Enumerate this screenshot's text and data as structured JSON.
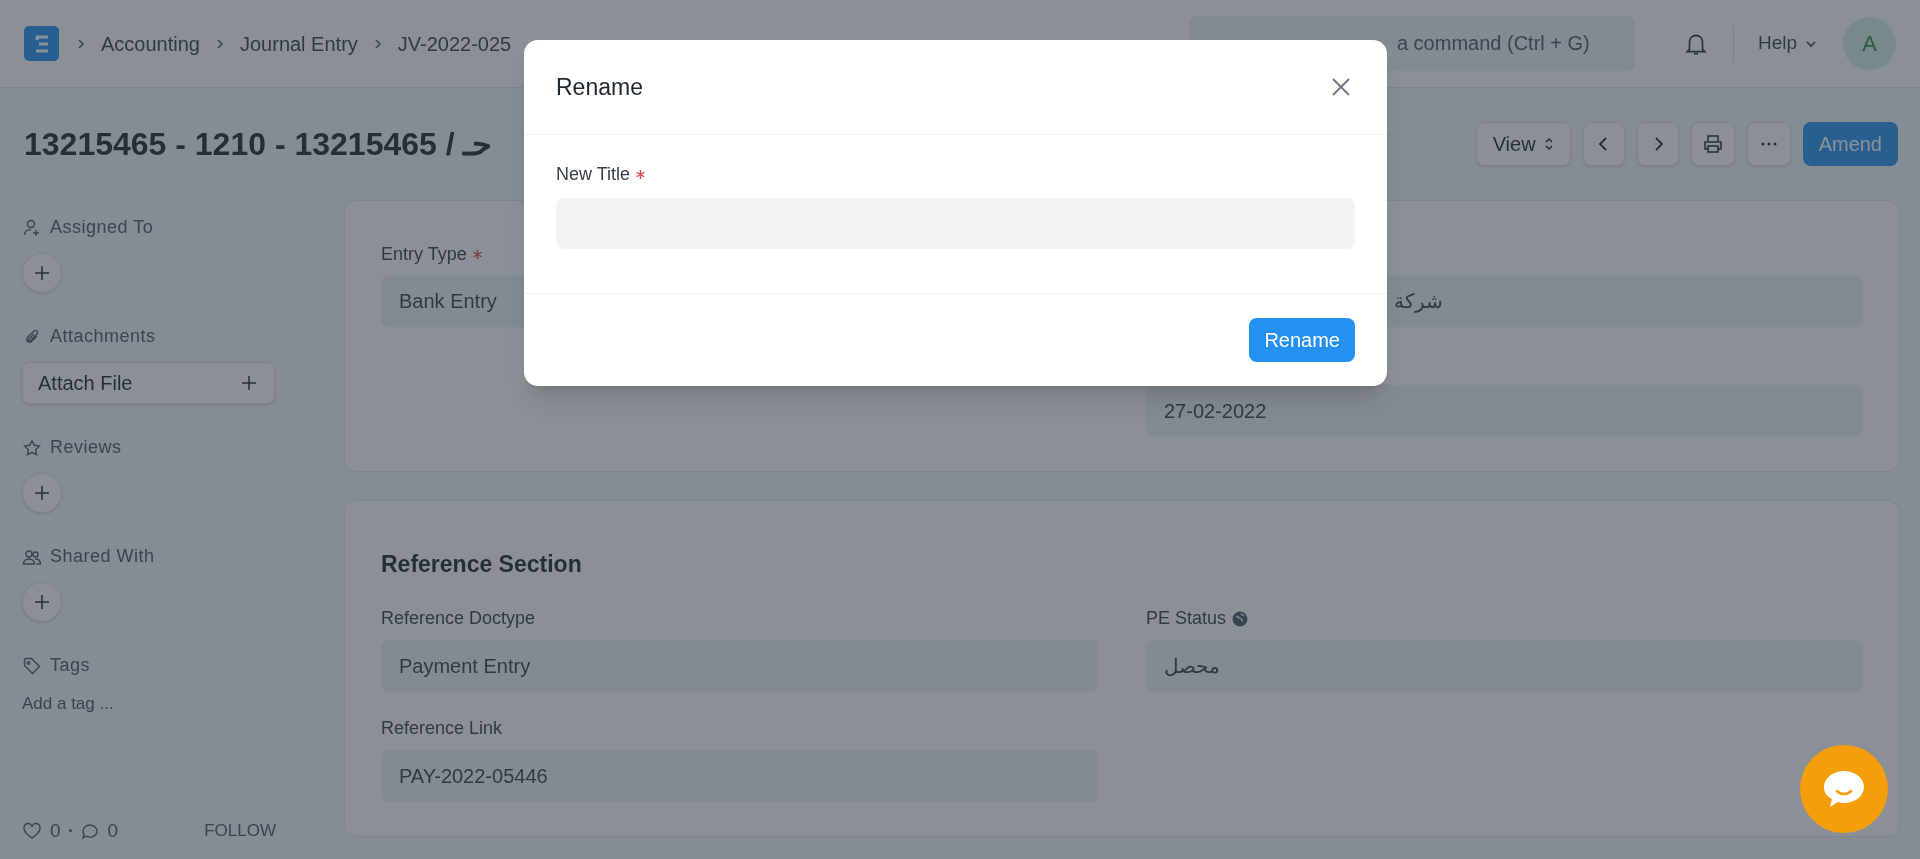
{
  "navbar": {
    "breadcrumbs": [
      "Accounting",
      "Journal Entry",
      "JV-2022-025"
    ],
    "search": {
      "placeholder": "a command (Ctrl + G)"
    },
    "help": "Help",
    "avatar": "A"
  },
  "page": {
    "title": "13215465 - 1210 - 13215465 / حـ",
    "view_button": "View",
    "primary_button": "Amend"
  },
  "sidebar": {
    "sections": [
      {
        "kind": "add",
        "label": "Assigned To"
      },
      {
        "kind": "attach",
        "label": "Attachments",
        "button": "Attach File"
      },
      {
        "kind": "add",
        "label": "Reviews"
      },
      {
        "kind": "add",
        "label": "Shared With"
      },
      {
        "kind": "tags",
        "label": "Tags",
        "placeholder": "Add a tag ..."
      }
    ],
    "likes": "0",
    "comments": "0",
    "follow": "FOLLOW"
  },
  "sections": [
    {
      "left": [
        {
          "label": "Entry Type",
          "required": true,
          "value": "Bank Entry"
        }
      ],
      "right": [
        {
          "value": "شركة"
        },
        {
          "value": "27-02-2022"
        }
      ]
    },
    {
      "heading": "Reference Section",
      "left": [
        {
          "label": "Reference Doctype",
          "value": "Payment Entry"
        },
        {
          "label": "Reference Link",
          "value": "PAY-2022-05446"
        }
      ],
      "right": [
        {
          "label": "PE Status",
          "info": true,
          "value": "محصل"
        }
      ]
    }
  ],
  "dialog": {
    "title": "Rename",
    "field": {
      "label": "New Title",
      "required": true
    },
    "button": "Rename"
  }
}
